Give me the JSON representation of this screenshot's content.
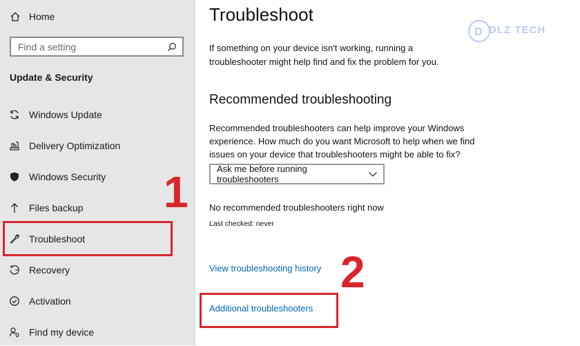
{
  "sidebar": {
    "home_label": "Home",
    "search_placeholder": "Find a setting",
    "section_title": "Update & Security",
    "items": [
      {
        "label": "Windows Update",
        "icon": "sync-icon"
      },
      {
        "label": "Delivery Optimization",
        "icon": "delivery-optimization-icon"
      },
      {
        "label": "Windows Security",
        "icon": "shield-icon"
      },
      {
        "label": "Files backup",
        "icon": "upload-arrow-icon"
      },
      {
        "label": "Troubleshoot",
        "icon": "wrench-icon"
      },
      {
        "label": "Recovery",
        "icon": "recovery-icon"
      },
      {
        "label": "Activation",
        "icon": "activation-check-icon"
      },
      {
        "label": "Find my device",
        "icon": "person-location-icon"
      }
    ]
  },
  "main": {
    "title": "Troubleshoot",
    "intro": "If something on your device isn't working, running a troubleshooter might help find and fix the problem for you.",
    "recommended_heading": "Recommended troubleshooting",
    "recommended_text": "Recommended troubleshooters can help improve your Windows experience. How much do you want Microsoft to help when we find issues on your device that troubleshooters might be able to fix?",
    "dropdown_value": "Ask me before running troubleshooters",
    "status": "No recommended troubleshooters right now",
    "last_checked": "Last checked: never",
    "history_link": "View troubleshooting history",
    "additional_link": "Additional troubleshooters"
  },
  "annotations": {
    "step1": "1",
    "step2": "2",
    "watermark_text": "DLZ TECH",
    "highlight_color": "#d7262e"
  },
  "colors": {
    "sidebar_bg": "#e6e6e6",
    "link": "#0066b4",
    "annotation_red": "#d7262e"
  }
}
